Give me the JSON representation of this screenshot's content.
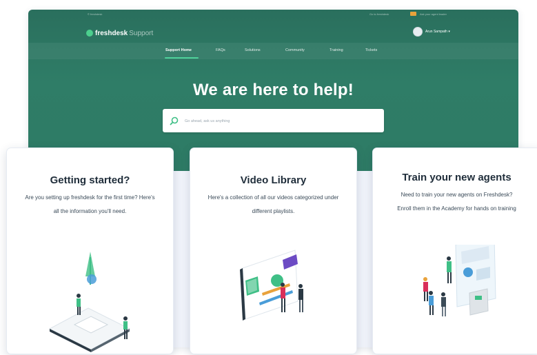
{
  "topstrip": {
    "left": "© freshdesk",
    "right1": "Go to freshdesk",
    "right2": "Ask your agent leader"
  },
  "header": {
    "logo_primary": "freshdesk",
    "logo_secondary": "Support",
    "user_name": "Arun Sampath ▾"
  },
  "nav": {
    "items": [
      {
        "label": "Support Home",
        "active": true
      },
      {
        "label": "FAQs"
      },
      {
        "label": "Solutions"
      },
      {
        "label": "Community"
      },
      {
        "label": "Training"
      },
      {
        "label": "Tickets"
      }
    ]
  },
  "hero": {
    "headline": "We are here to help!",
    "search_placeholder": "Go ahead, ask us anything"
  },
  "cards": [
    {
      "title": "Getting started?",
      "body": "Are you setting up freshdesk for the first time? Here's all the information you'll need."
    },
    {
      "title": "Video Library",
      "body": "Here's a collection of all our videos categorized under different playlists."
    },
    {
      "title": "Train your new agents",
      "body": "Need to train your new agents on Freshdesk? Enroll them in the Academy for hands on training"
    }
  ],
  "icons": [
    "search-icon",
    "logo-badge-icon",
    "avatar-icon",
    "flag-icon"
  ],
  "colors": {
    "hero": "#2f7d67",
    "accent": "#4fd39b",
    "card_bg": "#ffffff",
    "page_bg": "#f1f4fb"
  }
}
